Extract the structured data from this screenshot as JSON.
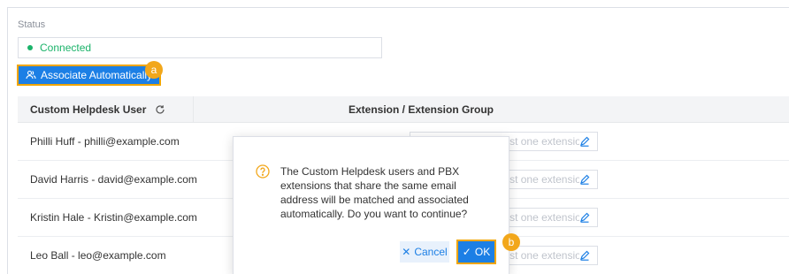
{
  "status": {
    "label": "Status",
    "value": "Connected",
    "dot_color": "#1bb36a"
  },
  "toolbar": {
    "associate_label": "Associate Automatically",
    "associate_icon": "users-icon"
  },
  "markers": {
    "a": "a",
    "b": "b"
  },
  "table": {
    "col_user": "Custom Helpdesk User",
    "col_ext": "Extension / Extension Group",
    "rows": [
      {
        "user": "Philli Huff - philli@example.com",
        "placeholder": "Please select at least one extension."
      },
      {
        "user": "David Harris - david@example.com",
        "placeholder": "Please select at least one extension."
      },
      {
        "user": "Kristin Hale - Kristin@example.com",
        "placeholder": "Please select at least one extension."
      },
      {
        "user": "Leo Ball - leo@example.com",
        "placeholder": "Please select at least one extension."
      }
    ]
  },
  "dialog": {
    "message": "The Custom Helpdesk users and PBX extensions that share the same email address will be matched and associated automatically. Do you want to continue?",
    "cancel_label": "Cancel",
    "ok_label": "OK",
    "icon": "question-circle-icon"
  },
  "colors": {
    "accent": "#1c7fe5",
    "highlight": "#f0a500",
    "marker": "#f2a71b"
  }
}
